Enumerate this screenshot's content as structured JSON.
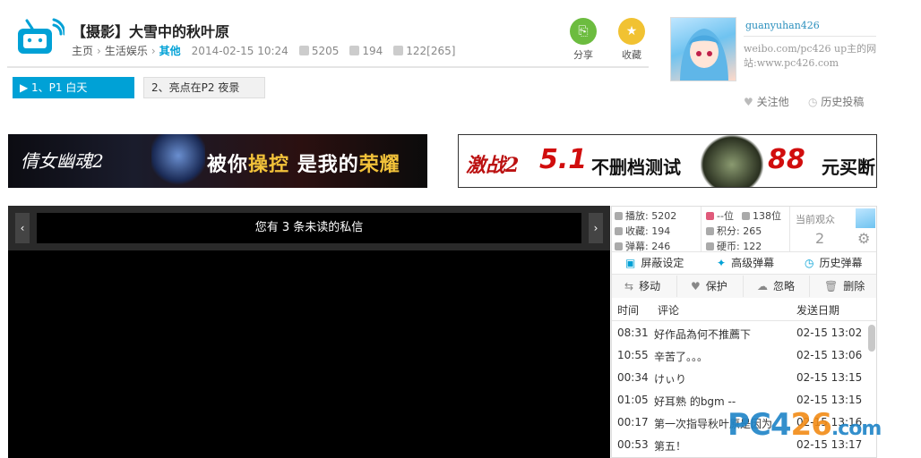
{
  "video": {
    "title": "【摄影】大雪中的秋叶原",
    "breadcrumb": [
      "主页",
      "生活娱乐",
      "其他"
    ],
    "date": "2014-02-15 10:24",
    "plays": "5205",
    "favorites": "194",
    "danmaku_info": "122[265]"
  },
  "actions": {
    "share": "分享",
    "favorite": "收藏"
  },
  "uploader": {
    "name": "guanyuhan426",
    "desc": "weibo.com/pc426 up主的网站:www.pc426.com",
    "follow": "关注他",
    "history": "历史投稿"
  },
  "parts": [
    "1、P1 白天",
    "2、亮点在P2 夜景"
  ],
  "ads": {
    "left": {
      "game": "倩女幽魂2",
      "slogan_white1": "被你",
      "slogan_gold1": "操控",
      "slogan_white2": " 是我的",
      "slogan_gold2": "荣耀"
    },
    "right": {
      "game": "激战2",
      "t1": "5.1",
      "t2": "不删档测试",
      "t3": "88",
      "t4": "元买断"
    }
  },
  "player": {
    "message": "您有 3 条未读的私信",
    "prev": "‹",
    "next": "›"
  },
  "stats": {
    "play": "播放: 5202",
    "fav": "收藏: 194",
    "danmaku": "弹幕: 246",
    "rank": "--位",
    "rank2": "138位",
    "score": "积分: 265",
    "coins": "硬币: 122",
    "viewers_label": "当前观众",
    "viewers": "2"
  },
  "tools": [
    "屏蔽设定",
    "高级弹幕",
    "历史弹幕"
  ],
  "comment_actions": [
    "移动",
    "保护",
    "忽略",
    "删除"
  ],
  "list": {
    "headers": [
      "时间",
      "评论",
      "发送日期"
    ],
    "rows": [
      {
        "time": "08:31",
        "comment": "好作品為何不推薦下",
        "date": "02-15 13:02"
      },
      {
        "time": "10:55",
        "comment": "辛苦了。。。",
        "date": "02-15 13:06"
      },
      {
        "time": "00:34",
        "comment": "けぃり",
        "date": "02-15 13:15"
      },
      {
        "time": "01:05",
        "comment": "好耳熟 的bgm --",
        "date": "02-15 13:15"
      },
      {
        "time": "00:17",
        "comment": "第一次指导秋叶原是因为",
        "date": "02-15 13:16"
      },
      {
        "time": "00:53",
        "comment": "第五！",
        "date": "02-15 13:17"
      }
    ]
  },
  "watermark": {
    "pc": "PC4",
    "num": "26",
    "dot": ".com"
  }
}
